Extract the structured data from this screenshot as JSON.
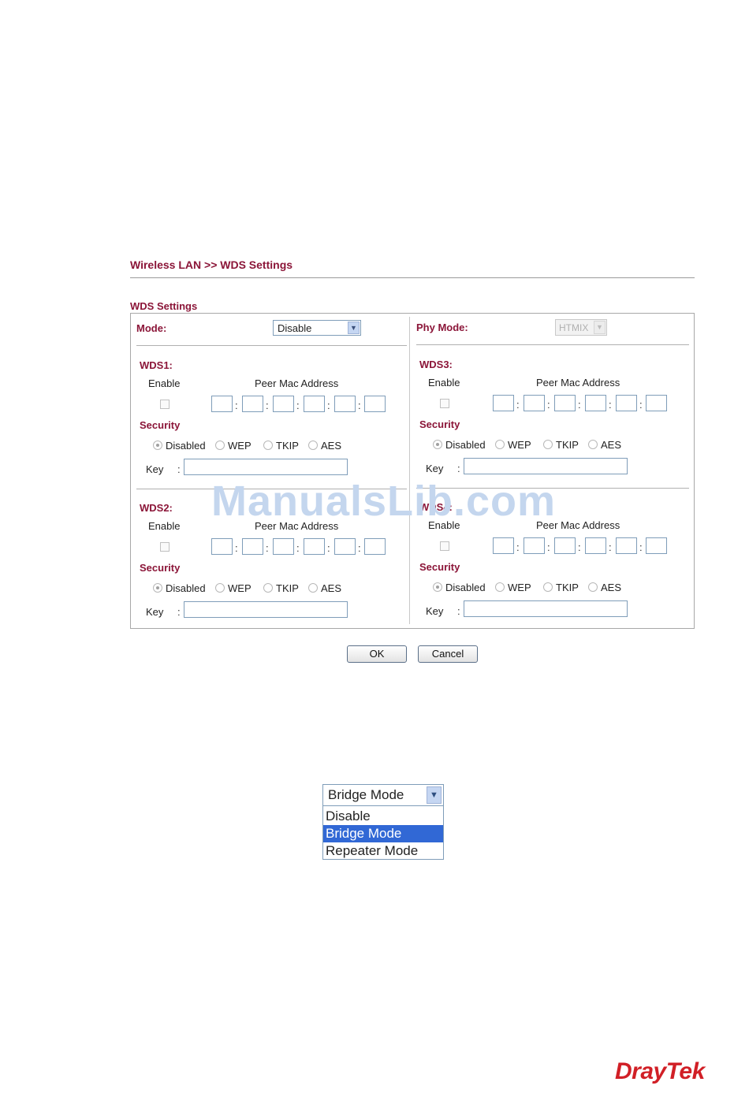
{
  "page": {
    "title": "Wireless LAN >> WDS Settings",
    "section_title": "WDS Settings"
  },
  "mode": {
    "label": "Mode:",
    "value": "Disable"
  },
  "phy_mode": {
    "label": "Phy Mode:",
    "value": "HTMIX"
  },
  "wds": [
    {
      "name": "WDS1:",
      "enable_label": "Enable",
      "peer_label": "Peer Mac Address",
      "security_label": "Security",
      "key_label": "Key",
      "colon": ":"
    },
    {
      "name": "WDS2:",
      "enable_label": "Enable",
      "peer_label": "Peer Mac Address",
      "security_label": "Security",
      "key_label": "Key",
      "colon": ":"
    },
    {
      "name": "WDS3:",
      "enable_label": "Enable",
      "peer_label": "Peer Mac Address",
      "security_label": "Security",
      "key_label": "Key",
      "colon": ":"
    },
    {
      "name": "WDS4:",
      "enable_label": "Enable",
      "peer_label": "Peer Mac Address",
      "security_label": "Security",
      "key_label": "Key",
      "colon": ":"
    }
  ],
  "security_options": [
    "Disabled",
    "WEP",
    "TKIP",
    "AES"
  ],
  "security_selected": "Disabled",
  "buttons": {
    "ok": "OK",
    "cancel": "Cancel"
  },
  "watermark": "ManualsLib.com",
  "dropdown": {
    "selected": "Bridge Mode",
    "options": [
      "Disable",
      "Bridge Mode",
      "Repeater Mode"
    ],
    "highlighted": "Bridge Mode"
  },
  "brand": {
    "name": "DrayTek",
    "color": "#d11f26"
  },
  "colors": {
    "accent": "#8b1538",
    "highlight": "#3168d5"
  },
  "icons": {
    "dropdown_arrow": "chevron-down-icon"
  }
}
